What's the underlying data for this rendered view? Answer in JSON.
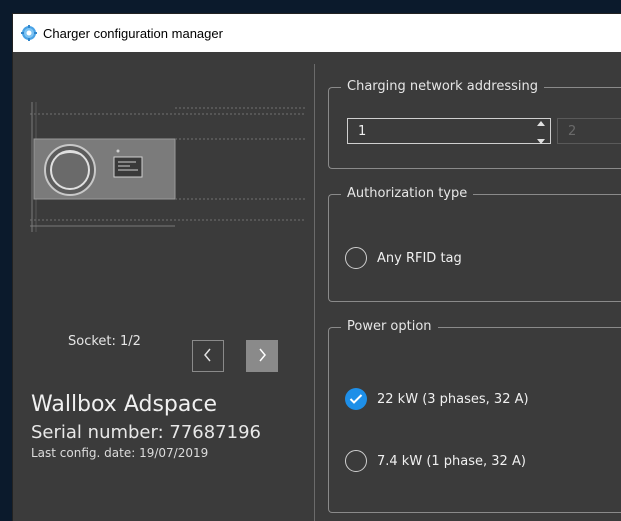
{
  "window": {
    "title": "Charger configuration manager"
  },
  "socket": {
    "label": "Socket: 1/2"
  },
  "device": {
    "name": "Wallbox Adspace",
    "serial": "Serial number: 77687196",
    "last_config": "Last config. date: 19/07/2019"
  },
  "network": {
    "legend": "Charging network addressing",
    "address_value": "1",
    "secondary_value": "2"
  },
  "authorization": {
    "legend": "Authorization type",
    "options": [
      {
        "label": "Any RFID tag",
        "checked": false
      }
    ]
  },
  "power": {
    "legend": "Power option",
    "options": [
      {
        "label": "22 kW (3 phases, 32 A)",
        "checked": true
      },
      {
        "label": "7.4 kW (1 phase, 32 A)",
        "checked": false
      }
    ]
  },
  "colors": {
    "background": "#3b3b3b",
    "accent": "#1e8fe8",
    "desktop": "#0b1a2c"
  }
}
